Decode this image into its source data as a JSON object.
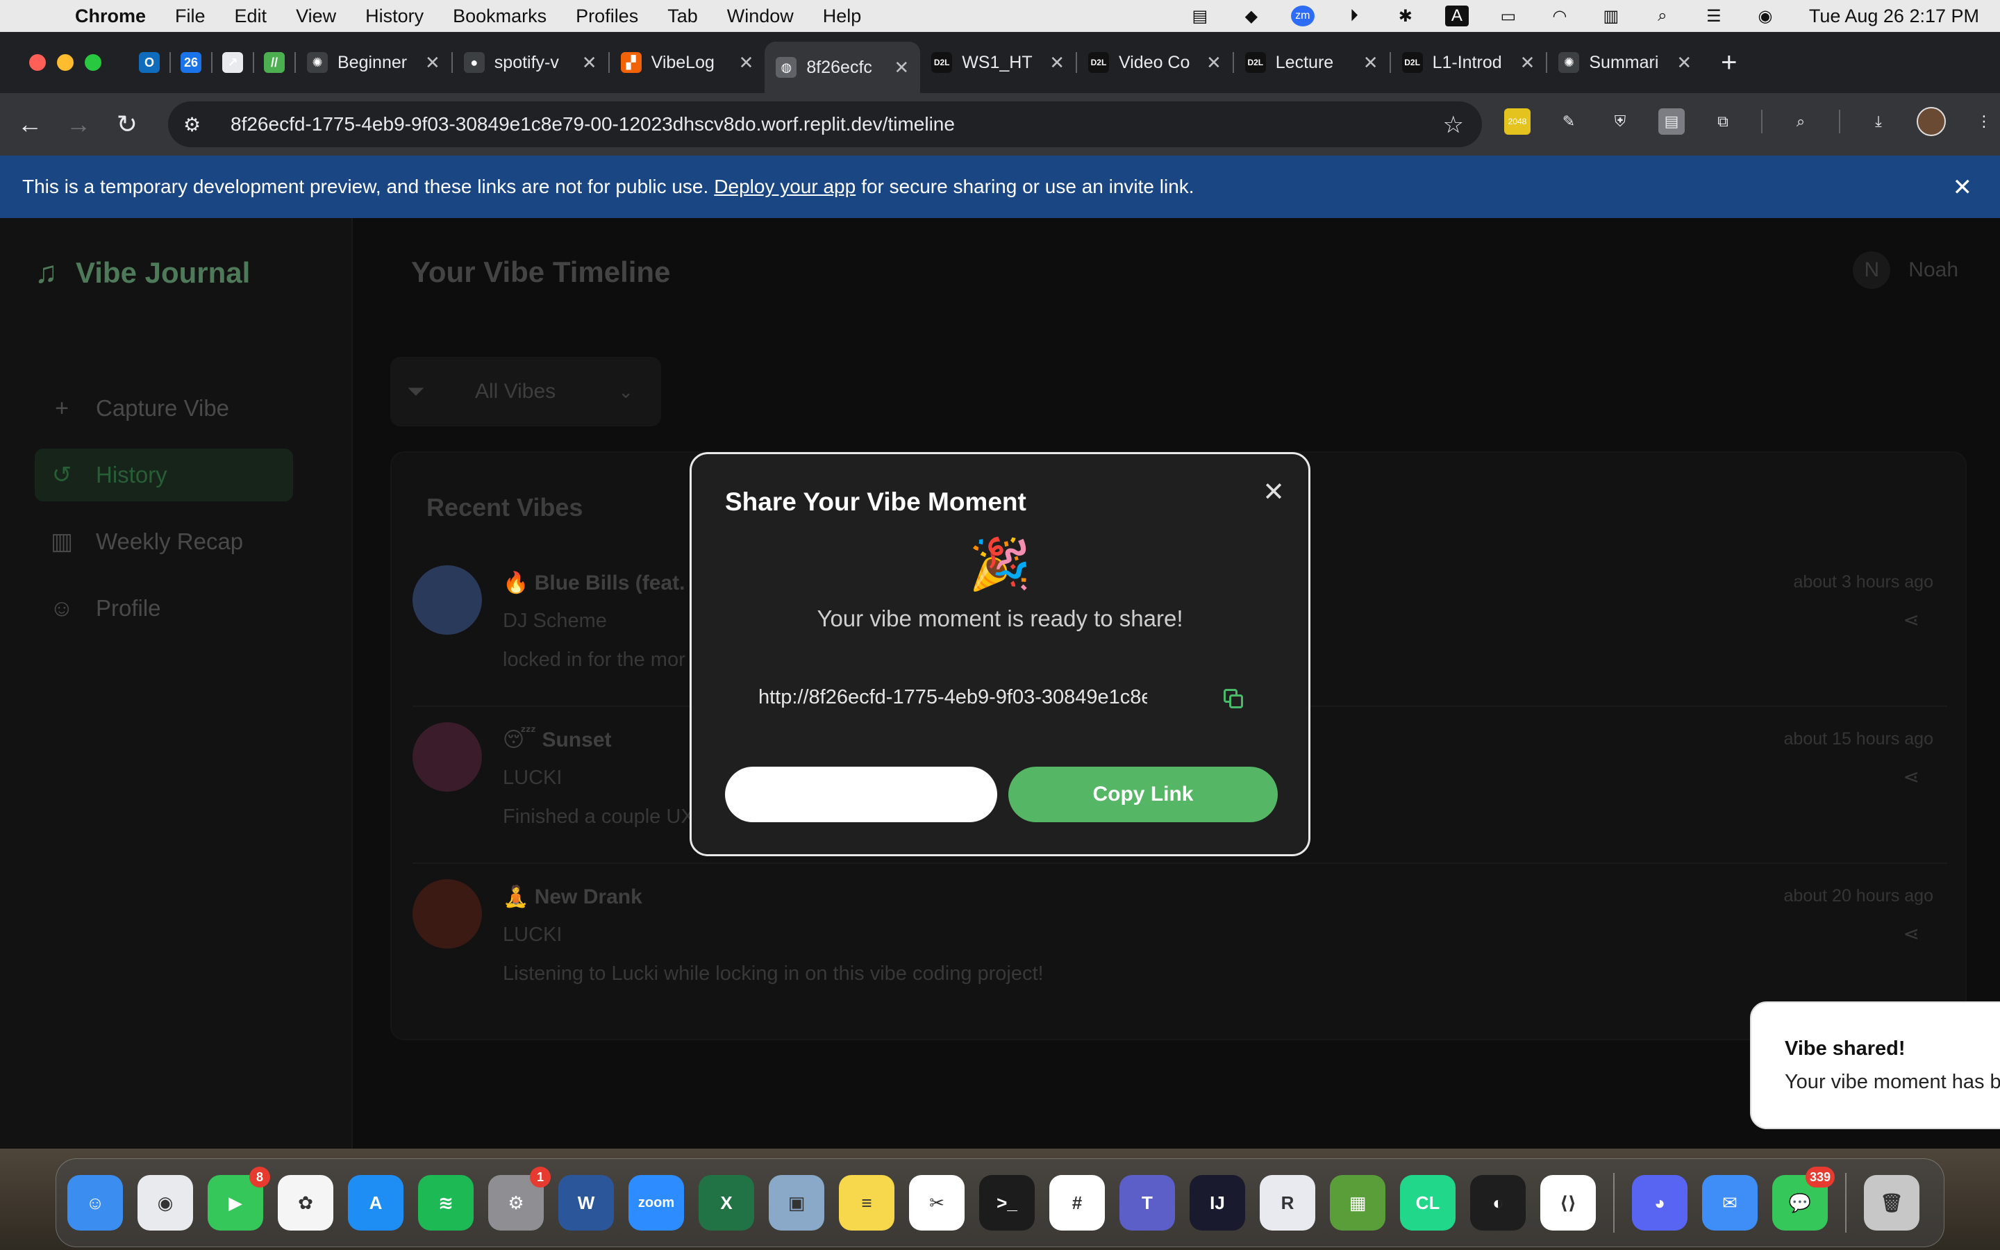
{
  "menubar": {
    "app": "Chrome",
    "items": [
      "File",
      "Edit",
      "View",
      "History",
      "Bookmarks",
      "Profiles",
      "Tab",
      "Window",
      "Help"
    ],
    "clock": "Tue Aug 26  2:17 PM"
  },
  "tabs": [
    {
      "label": "",
      "favicon": "outlook-icon",
      "fav_color": "#0f6cbd",
      "fav_text": "O"
    },
    {
      "label": "",
      "favicon": "calendar-icon",
      "fav_color": "#1a73e8",
      "fav_text": "26"
    },
    {
      "label": "",
      "favicon": "chart-icon",
      "fav_color": "#e8eaed",
      "fav_text": "↗"
    },
    {
      "label": "",
      "favicon": "slashes-icon",
      "fav_color": "#4caf50",
      "fav_text": "//"
    },
    {
      "label": "Beginner",
      "favicon": "openai-icon",
      "fav_color": "#3c4043",
      "fav_text": "✺"
    },
    {
      "label": "spotify-v",
      "favicon": "github-icon",
      "fav_color": "#3c4043",
      "fav_text": "●"
    },
    {
      "label": "VibeLog",
      "favicon": "replit-icon",
      "fav_color": "#f26207",
      "fav_text": "▞"
    },
    {
      "label": "8f26ecfc",
      "favicon": "globe-icon",
      "fav_color": "#5f6368",
      "fav_text": "◍",
      "active": true
    },
    {
      "label": "WS1_HT",
      "favicon": "d2l-icon",
      "fav_color": "#111",
      "fav_text": "D2L"
    },
    {
      "label": "Video Co",
      "favicon": "d2l-icon",
      "fav_color": "#111",
      "fav_text": "D2L"
    },
    {
      "label": "Lecture",
      "favicon": "d2l-icon",
      "fav_color": "#111",
      "fav_text": "D2L"
    },
    {
      "label": "L1-Introd",
      "favicon": "d2l-icon",
      "fav_color": "#111",
      "fav_text": "D2L"
    },
    {
      "label": "Summari",
      "favicon": "openai-icon",
      "fav_color": "#3c4043",
      "fav_text": "✺"
    }
  ],
  "toolbar": {
    "url": "8f26ecfd-1775-4eb9-9f03-30849e1c8e79-00-12023dhscv8do.worf.replit.dev/timeline"
  },
  "banner": {
    "text_before": "This is a temporary development preview, and these links are not for public use.",
    "link": "Deploy your app",
    "text_after": "for secure sharing or use an invite link."
  },
  "app": {
    "brand": "Vibe Journal",
    "nav": [
      {
        "label": "Capture Vibe",
        "icon": "plus-icon",
        "glyph": "+"
      },
      {
        "label": "History",
        "icon": "history-icon",
        "glyph": "↺",
        "active": true
      },
      {
        "label": "Weekly Recap",
        "icon": "bar-chart-icon",
        "glyph": "▥"
      },
      {
        "label": "Profile",
        "icon": "user-icon",
        "glyph": "☺"
      }
    ],
    "page_title": "Your Vibe Timeline",
    "user_initial": "N",
    "user_name": "Noah",
    "filter_value": "All Vibes",
    "card_title": "Recent Vibes",
    "vibes": [
      {
        "emoji": "🔥",
        "song": "Blue Bills (feat. S",
        "artist": "DJ Scheme",
        "note": "locked in for the mor",
        "time": "about 3 hours ago",
        "art_color": "#2a3a5a"
      },
      {
        "emoji": "😴",
        "song": "Sunset",
        "artist": "LUCKI",
        "note": "Finished a couple UX",
        "time": "about 15 hours ago",
        "art_color": "#3a1c2a"
      },
      {
        "emoji": "🧘",
        "song": "New Drank",
        "artist": "LUCKI",
        "note": "Listening to Lucki while locking in on this vibe coding project!",
        "time": "about 20 hours ago",
        "art_color": "#3a1a12"
      }
    ]
  },
  "modal": {
    "title": "Share Your Vibe Moment",
    "emoji": "🎉",
    "message": "Your vibe moment is ready to share!",
    "link": "http://8f26ecfd-1775-4eb9-9f03-30849e1c8e",
    "secondary_label": "",
    "primary_label": "Copy Link"
  },
  "toast": {
    "title": "Vibe shared!",
    "description": "Your vibe moment has b"
  },
  "dock": [
    {
      "name": "finder-icon",
      "color": "#3b8ef0",
      "glyph": "☺"
    },
    {
      "name": "chrome-icon",
      "color": "#e8eaed",
      "glyph": "◉"
    },
    {
      "name": "facetime-icon",
      "color": "#35c759",
      "glyph": "▶",
      "badge": "8"
    },
    {
      "name": "photos-icon",
      "color": "#f5f5f5",
      "glyph": "✿"
    },
    {
      "name": "app-store-icon",
      "color": "#1e8ef5",
      "glyph": "A"
    },
    {
      "name": "spotify-icon",
      "color": "#1db954",
      "glyph": "≋"
    },
    {
      "name": "system-settings-icon",
      "color": "#8e8e93",
      "glyph": "⚙",
      "badge": "1"
    },
    {
      "name": "word-icon",
      "color": "#2b579a",
      "glyph": "W"
    },
    {
      "name": "zoom-icon",
      "color": "#2d8cff",
      "glyph": "zoom"
    },
    {
      "name": "excel-icon",
      "color": "#217346",
      "glyph": "X"
    },
    {
      "name": "preview-icon",
      "color": "#8aa8c8",
      "glyph": "▣"
    },
    {
      "name": "notes-icon",
      "color": "#f7d74b",
      "glyph": "≡"
    },
    {
      "name": "capcut-icon",
      "color": "#ffffff",
      "glyph": "✂"
    },
    {
      "name": "terminal-icon",
      "color": "#1c1c1c",
      "glyph": ">_"
    },
    {
      "name": "slack-icon",
      "color": "#ffffff",
      "glyph": "#"
    },
    {
      "name": "teams-icon",
      "color": "#5b5fc7",
      "glyph": "T"
    },
    {
      "name": "intellij-icon",
      "color": "#1a1a2e",
      "glyph": "IJ"
    },
    {
      "name": "r-icon",
      "color": "#e8eaf0",
      "glyph": "R"
    },
    {
      "name": "minecraft-icon",
      "color": "#5a9e3a",
      "glyph": "▦"
    },
    {
      "name": "clion-icon",
      "color": "#21d789",
      "glyph": "CL"
    },
    {
      "name": "figma-icon",
      "color": "#1e1e1e",
      "glyph": "◐"
    },
    {
      "name": "vscode-icon",
      "color": "#ffffff",
      "glyph": "⟨⟩"
    },
    {
      "sep": true
    },
    {
      "name": "discord-icon",
      "color": "#5865f2",
      "glyph": "◕"
    },
    {
      "name": "mail-icon",
      "color": "#3f8df7",
      "glyph": "✉"
    },
    {
      "name": "messages-icon",
      "color": "#35c759",
      "glyph": "💬",
      "badge": "339"
    },
    {
      "sep": true
    },
    {
      "name": "trash-icon",
      "color": "#c7c7c7",
      "glyph": "🗑"
    }
  ]
}
